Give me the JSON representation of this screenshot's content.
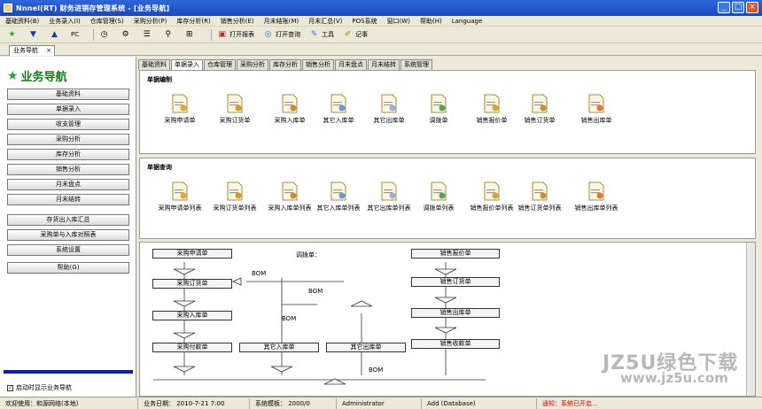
{
  "window": {
    "title": "Nnnel(RT)   财务进销存管理系统  - [业务导航]"
  },
  "menu": [
    "基础资料(B)",
    "业务录入(I)",
    "仓库管理(S)",
    "采购分析(P)",
    "库存分析(R)",
    "销售分析(E)",
    "月末结账(M)",
    "月末汇总(V)",
    "POS系统",
    "窗口(W)",
    "帮助(H)",
    "Language"
  ],
  "toolbar": {
    "btn_a": "PC",
    "open_table": "打开报表",
    "open_query": "打开查询",
    "tools": "工具",
    "notes": "记事"
  },
  "doc_tab": "业务导航",
  "nav": {
    "title": "业务导航",
    "buttons": [
      "基础资料",
      "单据录入",
      "收支管理",
      "采购分析",
      "库存分析",
      "销售分析",
      "月末盘点",
      "月末结转",
      "存货出入库汇总",
      "采购单与入库对照表",
      "系统设置",
      "帮助(G)"
    ],
    "startup_checkbox": "启动时显示业务导航"
  },
  "module_tabs": [
    "基础资料",
    "单据录入",
    "仓库管理",
    "采购分析",
    "库存分析",
    "销售分析",
    "月末盘点",
    "月末结转",
    "系统管理"
  ],
  "panel_entry": {
    "title": "单据编制",
    "items": [
      "采购申请单",
      "采购订货单",
      "采购入库单",
      "其它入库单",
      "其它出库单",
      "调拨单",
      "销售报价单",
      "销售订货单",
      "销售出库单"
    ]
  },
  "panel_query": {
    "title": "单据查询",
    "items": [
      "采购申请单列表",
      "采购订货单列表",
      "采购入库单列表",
      "其它入库单列表",
      "其它出库单列表",
      "调拨单列表",
      "销售报价单列表",
      "销售订货单列表",
      "销售出库单列表"
    ]
  },
  "flow": {
    "left_boxes": [
      "采购申请单",
      "采购订货单",
      "采购入库单",
      "采购付款单"
    ],
    "middle_boxes": [
      "其它入库单",
      "其它出库单"
    ],
    "right_boxes": [
      "销售报价单",
      "销售订货单",
      "销售出库单",
      "销售收款单"
    ],
    "labels": {
      "transfer": "调拨单：",
      "bom1": "BOM",
      "bom2": "BOM",
      "bom3": "BOM",
      "bom4": "BOM"
    }
  },
  "status": {
    "user": "欢迎使用：和源网络(本地)",
    "date": "业务日期： 2010-7-21 7:00",
    "sys": "系统模板： 2000/0",
    "admin": "Administrator",
    "db": "Add (Database)",
    "notice": "通知：系统已开启..."
  },
  "watermark": {
    "line1": "JZ5U绿色下载",
    "line2": "www.jz5u.com"
  }
}
